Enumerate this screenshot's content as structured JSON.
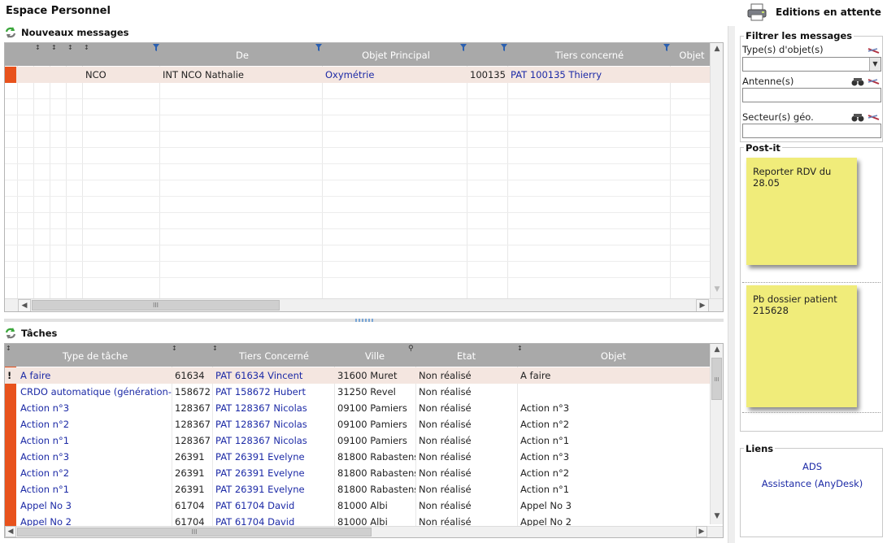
{
  "page": {
    "title": "Espace Personnel"
  },
  "editions": {
    "label": "Editions en attente"
  },
  "messages": {
    "title": "Nouveaux messages",
    "columns": {
      "de": "De",
      "objet_principal": "Objet Principal",
      "tiers": "Tiers concerné",
      "objet": "Objet"
    },
    "rows": [
      {
        "type": "NCO",
        "de": "INT NCO Nathalie",
        "objet_principal": "Oxymétrie",
        "tiers_id": "100135",
        "tiers": "PAT 100135 Thierry",
        "objet": ""
      }
    ]
  },
  "tasks": {
    "title": "Tâches",
    "columns": {
      "type": "Type  de tâche",
      "tiers": "Tiers Concerné",
      "ville": "Ville",
      "etat": "Etat",
      "objet": "Objet"
    },
    "rows": [
      {
        "flag": "!",
        "type": "A faire",
        "id": "61634",
        "tiers": "PAT 61634 Vincent",
        "ville": "31600 Muret",
        "etat": "Non réalisé",
        "objet": "A faire"
      },
      {
        "flag": "",
        "type": "CRDO automatique (génération-",
        "id": "158672",
        "tiers": "PAT 158672 Hubert",
        "ville": "31250 Revel",
        "etat": "Non réalisé",
        "objet": ""
      },
      {
        "flag": "",
        "type": "Action n°3",
        "id": "128367",
        "tiers": "PAT 128367 Nicolas",
        "ville": "09100 Pamiers",
        "etat": "Non réalisé",
        "objet": "Action n°3"
      },
      {
        "flag": "",
        "type": "Action n°2",
        "id": "128367",
        "tiers": "PAT 128367 Nicolas",
        "ville": "09100 Pamiers",
        "etat": "Non réalisé",
        "objet": "Action n°2"
      },
      {
        "flag": "",
        "type": "Action n°1",
        "id": "128367",
        "tiers": "PAT 128367 Nicolas",
        "ville": "09100 Pamiers",
        "etat": "Non réalisé",
        "objet": "Action n°1"
      },
      {
        "flag": "",
        "type": "Action n°3",
        "id": "26391",
        "tiers": "PAT 26391 Evelyne",
        "ville": "81800 Rabastens",
        "etat": "Non réalisé",
        "objet": "Action n°3"
      },
      {
        "flag": "",
        "type": "Action n°2",
        "id": "26391",
        "tiers": "PAT 26391 Evelyne",
        "ville": "81800 Rabastens",
        "etat": "Non réalisé",
        "objet": "Action n°2"
      },
      {
        "flag": "",
        "type": "Action n°1",
        "id": "26391",
        "tiers": "PAT 26391 Evelyne",
        "ville": "81800 Rabastens",
        "etat": "Non réalisé",
        "objet": "Action n°1"
      },
      {
        "flag": "",
        "type": "Appel No 3",
        "id": "61704",
        "tiers": "PAT 61704 David",
        "ville": "81000 Albi",
        "etat": "Non réalisé",
        "objet": "Appel No 3"
      },
      {
        "flag": "",
        "type": "Appel No 2",
        "id": "61704",
        "tiers": "PAT 61704 David",
        "ville": "81000 Albi",
        "etat": "Non réalisé",
        "objet": "Appel No 2"
      }
    ]
  },
  "filter": {
    "title": "Filtrer les messages",
    "type_label": "Type(s) d'objet(s)",
    "antenne_label": "Antenne(s)",
    "secteur_label": "Secteur(s) géo."
  },
  "postit": {
    "title": "Post-it",
    "notes": [
      "Reporter RDV du 28.05",
      "Pb dossier patient 215628"
    ]
  },
  "liens": {
    "title": "Liens",
    "items": [
      "ADS",
      "Assistance (AnyDesk)"
    ]
  },
  "colors": {
    "header_gray": "#a9a9a9",
    "flag_orange": "#e8521c",
    "link_blue": "#1c2aa6",
    "postit_yellow": "#f0ec7a",
    "selected_row": "#f4e6e0"
  },
  "scrollbar_glyph": "III"
}
